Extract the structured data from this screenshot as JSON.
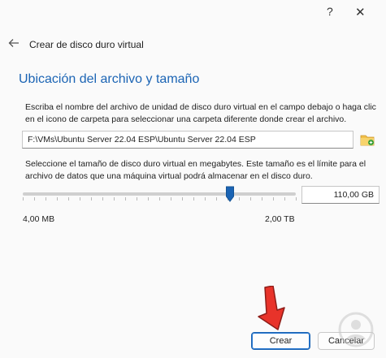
{
  "titlebar": {
    "help_label": "?",
    "close_label": "✕"
  },
  "dialog": {
    "title": "Crear de disco duro virtual"
  },
  "section": {
    "title": "Ubicación del archivo y tamaño"
  },
  "location": {
    "instructions": "Escriba el nombre del archivo de unidad de disco duro virtual en el campo debajo o haga clic en el icono de carpeta para seleccionar una carpeta diferente donde crear el archivo.",
    "path_value": "F:\\VMs\\Ubuntu Server 22.04 ESP\\Ubuntu Server 22.04 ESP",
    "folder_icon": "folder-icon"
  },
  "size": {
    "instructions": "Seleccione el tamaño de disco duro virtual en megabytes. Este tamaño es el límite para el archivo de datos que una máquina virtual podrá almacenar en el disco duro.",
    "value": "110,00 GB",
    "min_label": "4,00 MB",
    "max_label": "2,00 TB",
    "slider_fraction": 0.76
  },
  "buttons": {
    "create_label": "Crear",
    "cancel_label": "Cancelar"
  },
  "colors": {
    "accent": "#1b64b4",
    "arrow": "#e8332a"
  }
}
